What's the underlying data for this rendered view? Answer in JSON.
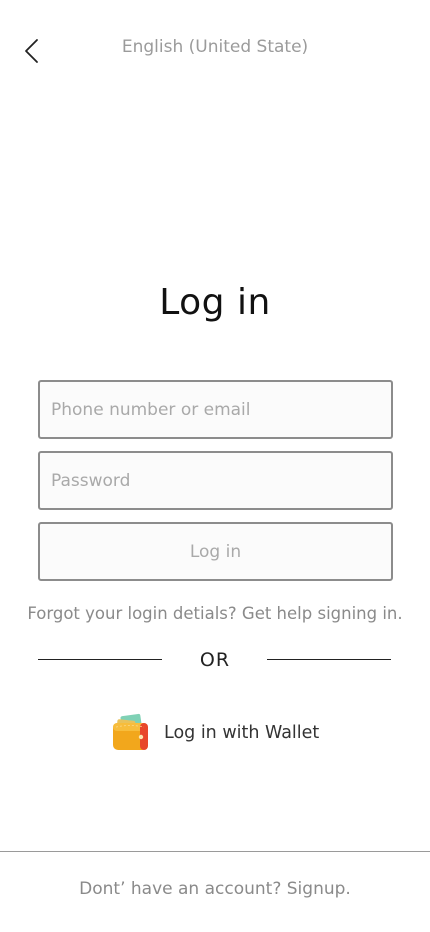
{
  "header": {
    "language_label": "English (United State)"
  },
  "login": {
    "title": "Log in",
    "phone_placeholder": "Phone number or email",
    "password_placeholder": "Password",
    "submit_label": "Log in",
    "forgot_prefix": "Forgot your login detials?",
    "forgot_link": "Get help signing in."
  },
  "divider": {
    "or_label": "OR"
  },
  "wallet": {
    "label": "Log in with Wallet",
    "icon": "wallet-icon"
  },
  "footer": {
    "signup_prefix": "Dont’ have an account?",
    "signup_link": "Signup."
  }
}
